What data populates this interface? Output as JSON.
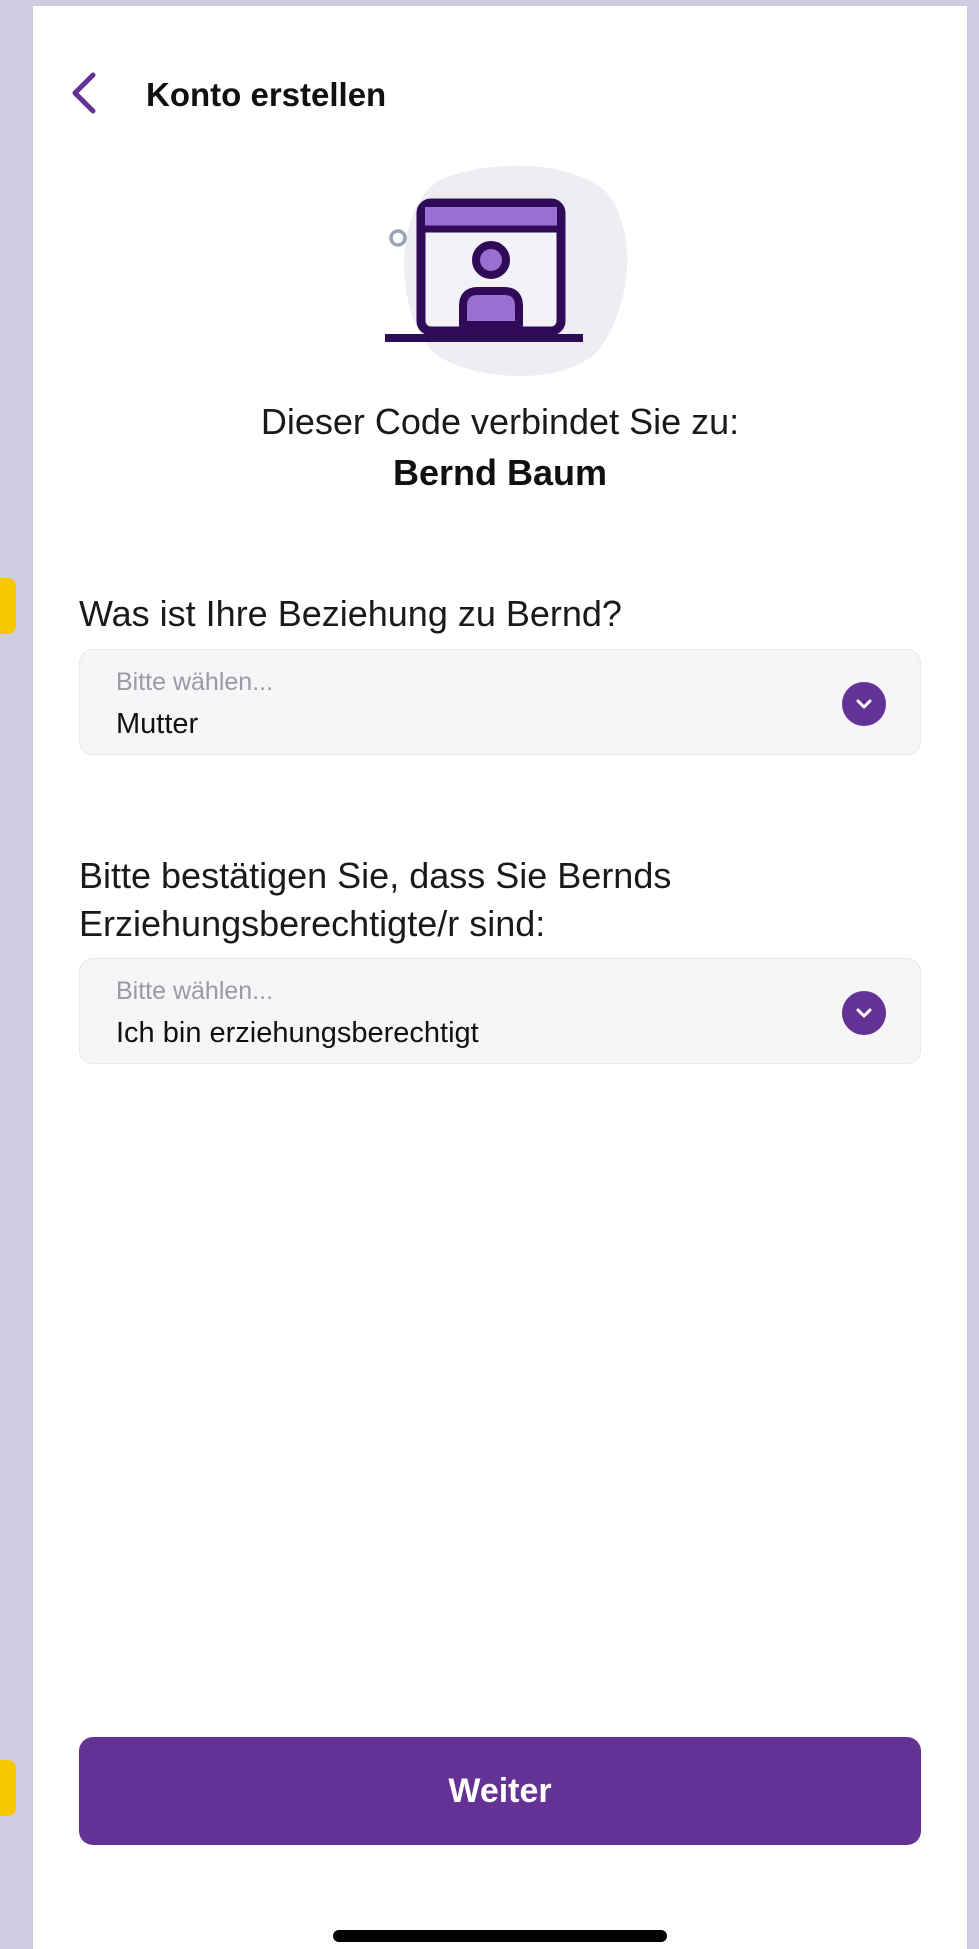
{
  "header": {
    "title": "Konto erstellen"
  },
  "connect": {
    "text": "Dieser Code verbindet Sie zu:",
    "name": "Bernd Baum"
  },
  "relationship": {
    "question": "Was ist Ihre Beziehung zu Bernd?",
    "placeholder": "Bitte wählen...",
    "value": "Mutter"
  },
  "guardian": {
    "question_line1": "Bitte bestätigen Sie, dass Sie Bernds",
    "question_line2": "Erziehungsberechtigte/r sind:",
    "placeholder": "Bitte wählen...",
    "value": "Ich bin erziehungsberechtigt"
  },
  "footer": {
    "continue_label": "Weiter"
  },
  "colors": {
    "accent": "#643195",
    "background": "#cdcce0",
    "marker": "#f7c800"
  }
}
